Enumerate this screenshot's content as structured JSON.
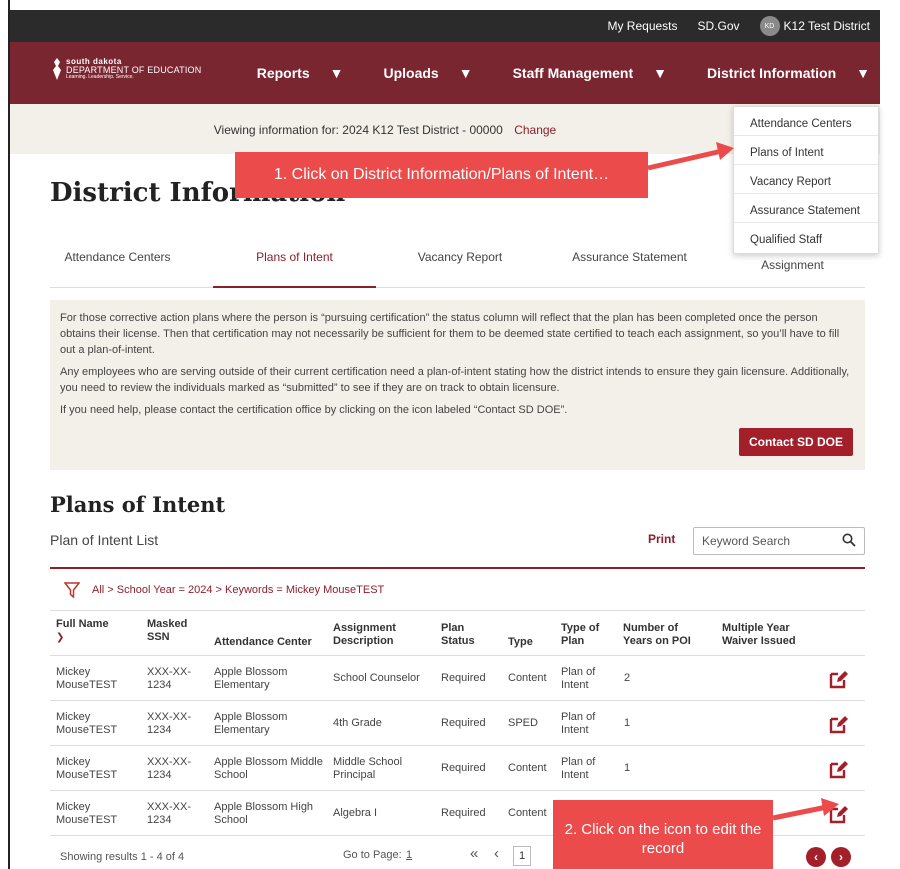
{
  "topbar": {
    "my_requests": "My Requests",
    "sd_gov": "SD.Gov",
    "avatar_initials": "KD",
    "district": "K12 Test District"
  },
  "brand": {
    "line1": "south dakota",
    "line2": "DEPARTMENT OF EDUCATION",
    "line3": "Learning. Leadership. Service."
  },
  "nav": {
    "items": [
      "Reports",
      "Uploads",
      "Staff Management",
      "District Information"
    ]
  },
  "viewing": {
    "label": "Viewing information for:",
    "value": "2024 K12 Test District - 00000",
    "change": "Change"
  },
  "dropdown": {
    "items": [
      "Attendance Centers",
      "Plans of Intent",
      "Vacancy Report",
      "Assurance Statement",
      "Qualified Staff"
    ]
  },
  "page_title": "District Information",
  "tabs": [
    "Attendance Centers",
    "Plans of Intent",
    "Vacancy Report",
    "Assurance Statement",
    "Assignment"
  ],
  "info": {
    "p1": "For those corrective action plans where the person is “pursuing certification” the status column will reflect that the plan has been completed once the person obtains their license. Then that certification may not necessarily be sufficient for them to be deemed state certified to teach each assignment, so you’ll have to fill out a plan-of-intent.",
    "p2": "Any employees who are serving outside of their current certification need a plan-of-intent stating how the district intends to ensure they gain licensure. Additionally, you need to review the individuals marked as “submitted” to see if they are on track to obtain licensure.",
    "p3": "If you need help, please contact the certification office by clicking on the icon labeled “Contact SD DOE”.",
    "contact_button": "Contact SD DOE"
  },
  "section": {
    "title": "Plans of Intent",
    "list_label": "Plan of Intent List",
    "print": "Print",
    "search_placeholder": "Keyword Search",
    "filter_text": "All > School Year = 2024 > Keywords = Mickey MouseTEST"
  },
  "table": {
    "headers": {
      "full_name": "Full Name",
      "masked_ssn": "Masked SSN",
      "attendance_center": "Attendance Center",
      "assignment": "Assignment Description",
      "plan_status": "Plan Status",
      "type": "Type",
      "type_of_plan": "Type of Plan",
      "years_on_poi": "Number of Years on POI",
      "waiver": "Multiple Year Waiver Issued"
    },
    "rows": [
      {
        "name": "Mickey MouseTEST",
        "ssn": "XXX-XX-1234",
        "center": "Apple Blossom Elementary",
        "assignment": "School Counselor",
        "status": "Required",
        "type": "Content",
        "plan": "Plan of Intent",
        "years": "2",
        "waiver": ""
      },
      {
        "name": "Mickey MouseTEST",
        "ssn": "XXX-XX-1234",
        "center": "Apple Blossom Elementary",
        "assignment": "4th Grade",
        "status": "Required",
        "type": "SPED",
        "plan": "Plan of Intent",
        "years": "1",
        "waiver": ""
      },
      {
        "name": "Mickey MouseTEST",
        "ssn": "XXX-XX-1234",
        "center": "Apple Blossom Middle School",
        "assignment": "Middle School Principal",
        "status": "Required",
        "type": "Content",
        "plan": "Plan of Intent",
        "years": "1",
        "waiver": ""
      },
      {
        "name": "Mickey MouseTEST",
        "ssn": "XXX-XX-1234",
        "center": "Apple Blossom High School",
        "assignment": "Algebra I",
        "status": "Required",
        "type": "Content",
        "plan": "",
        "years": "",
        "waiver": ""
      }
    ]
  },
  "footer": {
    "showing": "Showing results 1 - 4 of 4",
    "goto": "Go to Page:",
    "goto_value": "1",
    "current_page": "1"
  },
  "callouts": {
    "step1": "1.  Click on District Information/Plans of Intent…",
    "step2": "2.  Click on the icon to edit the record"
  },
  "colors": {
    "brand": "#7a2630",
    "accent": "#a31f2a",
    "callout": "#ec4b4b",
    "panel": "#f3efe9"
  }
}
